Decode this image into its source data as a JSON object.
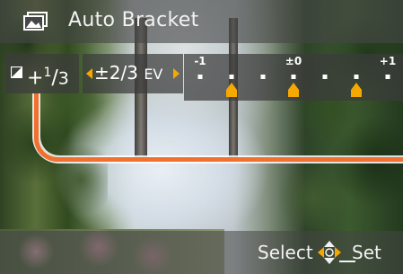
{
  "header": {
    "icon": "auto-bracket-icon",
    "title": "Auto Bracket"
  },
  "bracket": {
    "value_prefix": "+",
    "value_numerator": "1",
    "value_slash": "/",
    "value_denominator": "3",
    "step_value": "±2/3",
    "step_unit": "EV",
    "scale_labels": [
      "-1",
      "±0",
      "+1"
    ],
    "scale_marker_count": 3
  },
  "footer": {
    "select_label": "Select",
    "set_label": "Set",
    "dpad_icon": "dpad-icon"
  },
  "colors": {
    "accent": "#f5a800",
    "highlight": "#f07030",
    "overlay": "#464646"
  }
}
